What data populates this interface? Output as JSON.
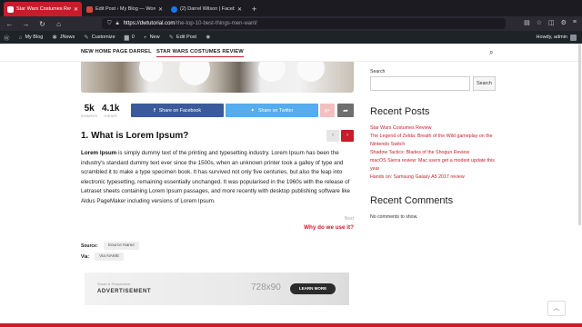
{
  "browser": {
    "tabs": [
      {
        "label": "Star Wars Costumes Review – d",
        "active": true,
        "favicon_color": "#ffffff"
      },
      {
        "label": "Edit Post ‹ My Blog — WordPress",
        "active": false,
        "favicon_color": "#e2403a"
      },
      {
        "label": "(2) Darrel Wilson | Facebook",
        "active": false,
        "favicon_color": "#1877f2"
      }
    ],
    "url_host": "https://dwtutorial.com",
    "url_path": "/the-top-10-best-things-men-want/",
    "icons": {
      "back": "←",
      "forward": "→",
      "reload": "↻",
      "home": "⌂"
    }
  },
  "adminbar": {
    "items": [
      "My Blog",
      "JNews",
      "Customize",
      "0",
      "New",
      "Edit Post"
    ],
    "greeting": "Howdy, admin"
  },
  "menu": {
    "items": [
      "NEW HOME PAGE",
      "DARREL",
      "STAR WARS COSTUMES REVIEW"
    ],
    "active_index": 2
  },
  "share": {
    "shares_count": "5k",
    "shares_label": "SHARES",
    "views_count": "4.1k",
    "views_label": "VIEWS",
    "facebook_label": "Share on Facebook",
    "twitter_label": "Share on Twitter"
  },
  "article": {
    "heading": "1. What is Lorem Ipsum?",
    "lead": "Lorem Ipsum",
    "body": " is simply dummy text of the printing and typesetting industry. Lorem Ipsum has been the industry's standard dummy text ever since the 1500s, when an unknown printer took a galley of type and scrambled it to make a type specimen book. It has survived not only five centuries, but also the leap into electronic typesetting, remaining essentially unchanged. It was popularised in the 1960s with the release of Letraset sheets containing Lorem Ipsum passages, and more recently with desktop publishing software like Aldus PageMaker including versions of Lorem Ipsum.",
    "next_label": "Next",
    "next_title": "Why do we use it?",
    "source_label": "Source:",
    "source_value": "Source Name",
    "via_label": "Via:",
    "via_value": "Via NAME"
  },
  "ad": {
    "small": "Smart & Responsive",
    "big": "ADVERTISEMENT",
    "dimensions": "728x90",
    "cta": "LEARN MORE"
  },
  "sidebar": {
    "search_label": "Search",
    "search_button": "Search",
    "recent_posts_title": "Recent Posts",
    "recent_posts": [
      "Star Wars Costumes Review",
      "The Legend of Zelda: Breath of the Wild gameplay on the Nintendo Switch",
      "Shadow Tactics: Blades of the Shogun Review",
      "macOS Sierra review: Mac users get a modest update this year",
      "Hands on: Samsung Galaxy A5 2017 review"
    ],
    "recent_comments_title": "Recent Comments",
    "no_comments": "No comments to show."
  },
  "colors": {
    "accent": "#c81c2a",
    "facebook": "#3b5a9a",
    "twitter": "#55acee"
  }
}
